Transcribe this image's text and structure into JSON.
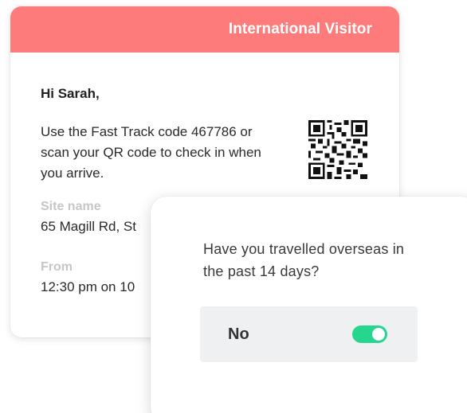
{
  "visitor_card": {
    "header_title": "International Visitor",
    "greeting": "Hi Sarah,",
    "message": "Use the Fast Track code 467786 or scan your QR code to check in when you arrive.",
    "site_label": "Site name",
    "site_value": "65 Magill Rd, St",
    "from_label": "From",
    "from_value": "12:30 pm on 10",
    "qr_icon": "qr-code",
    "header_color": "#fd7b7b"
  },
  "question_card": {
    "question": "Have you travelled overseas in the past 14 days?",
    "answer_label": "No",
    "toggle_on": true,
    "toggle_color": "#26d68f"
  }
}
